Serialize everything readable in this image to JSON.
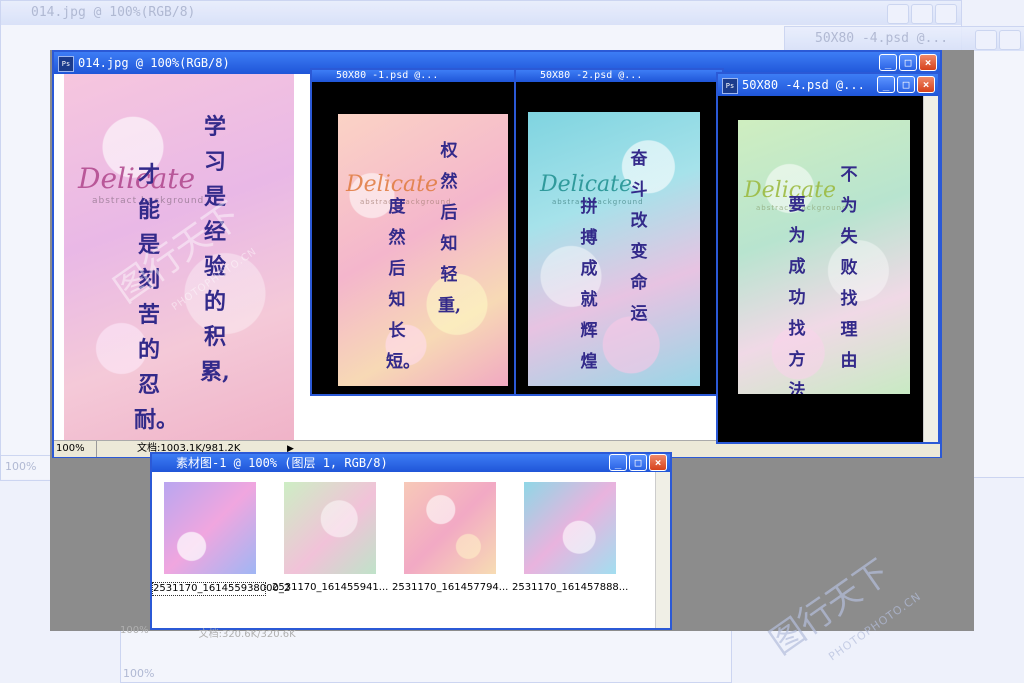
{
  "background_windows": [
    {
      "title": "014.jpg @ 100%(RGB/8)"
    },
    {
      "title": "50X80 -4.psd @..."
    },
    {
      "title": "100%"
    }
  ],
  "main_window": {
    "title": "014.jpg @ 100%(RGB/8)",
    "zoom": "100%",
    "doc_info": "文档:1003.1K/981.2K",
    "poster": {
      "brand": "Delicate",
      "sub": "abstract background",
      "col1": "学习是经验的积累,",
      "col2": "才能是刻苦的忍耐。"
    }
  },
  "win2": {
    "title": "50X80 -1.psd @...",
    "poster": {
      "brand": "Delicate",
      "sub": "abstract background",
      "col1": "权然后知轻重,",
      "col2": "度然后知长短。"
    }
  },
  "win3": {
    "title": "50X80 -2.psd @...",
    "poster": {
      "brand": "Delicate",
      "sub": "abstract background",
      "col1": "奋斗改变命运",
      "col2": "拼搏成就辉煌"
    }
  },
  "win4": {
    "title": "50X80 -4.psd @...",
    "poster": {
      "brand": "Delicate",
      "sub": "abstract background",
      "col1": "不为失败找理由",
      "col2": "要为成功找方法"
    }
  },
  "material_window": {
    "title": "素材图-1 @ 100% (图层 1, RGB/8)",
    "thumbs": [
      {
        "caption": "2531170_161455938000_2"
      },
      {
        "caption": "2531170_161455941..."
      },
      {
        "caption": "2531170_161457794..."
      },
      {
        "caption": "2531170_161457888..."
      }
    ]
  },
  "bottom_status": {
    "zoom": "100%",
    "doc_info": "文档:320.6K/320.6K"
  },
  "watermark": {
    "main": "图行天下",
    "sub": "PHOTOPHOTO.CN"
  },
  "colors": {
    "title_blue": "#2b59d6",
    "canvas_gray": "#8c8c8c",
    "text_indigo": "#332a8a"
  },
  "icons": {
    "minimize": "minimize-icon",
    "maximize": "maximize-icon",
    "close": "close-icon",
    "ps": "photoshop-icon"
  }
}
